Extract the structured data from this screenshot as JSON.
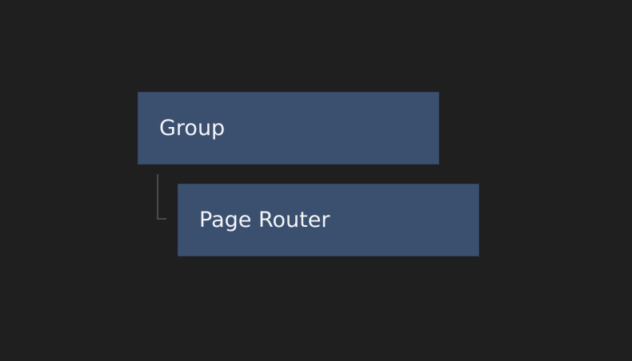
{
  "tree": {
    "root": {
      "label": "Group",
      "children": [
        {
          "label": "Page Router"
        }
      ]
    }
  },
  "colors": {
    "background": "#1f1f1f",
    "node_fill": "#3b4f6e",
    "node_text": "#f2f4f8",
    "connector": "#4a4a4a"
  }
}
